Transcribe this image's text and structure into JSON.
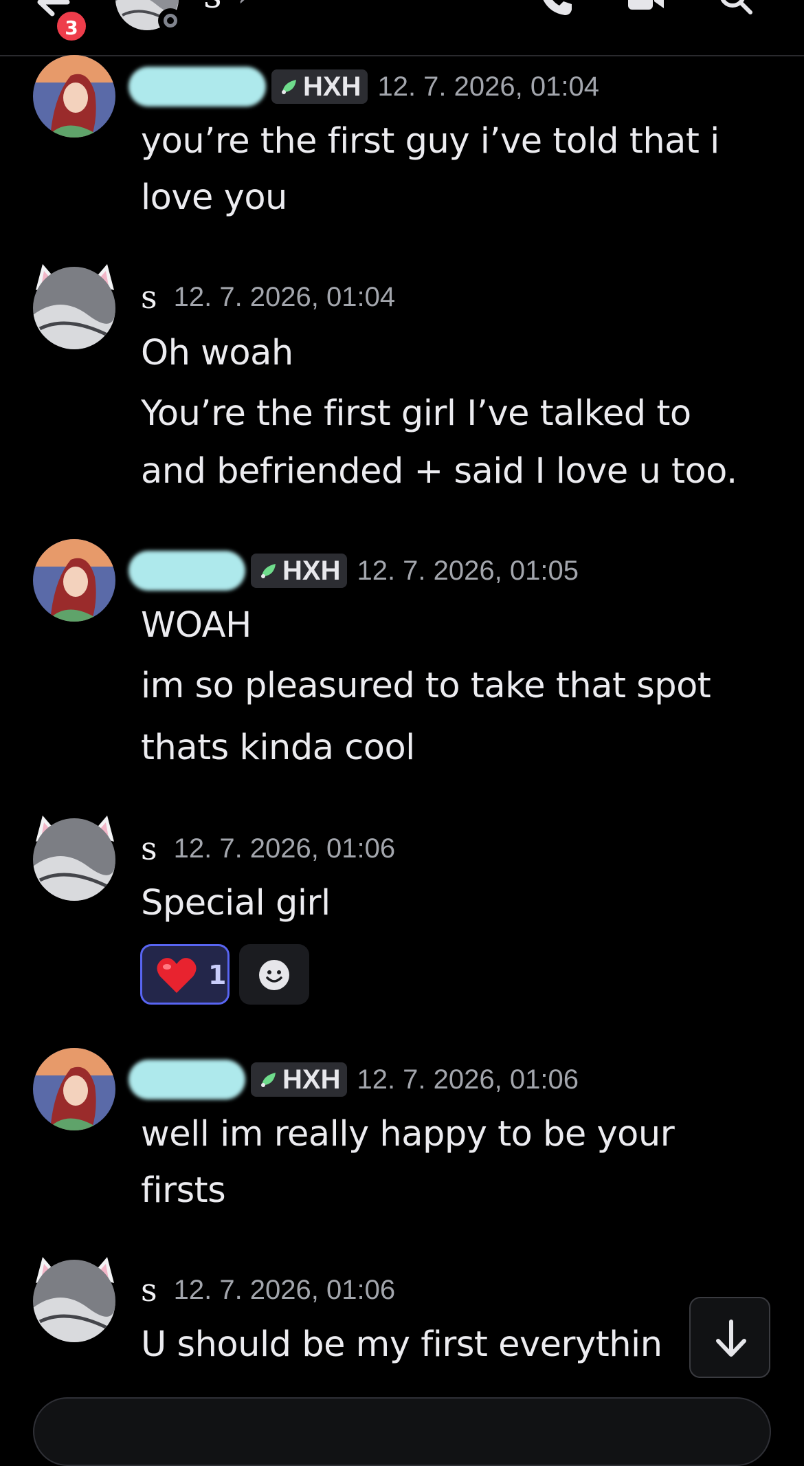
{
  "header": {
    "channel_name": "s",
    "chevron": "›",
    "unread_badge": "3",
    "icons": [
      "back-arrow-icon",
      "phone-icon",
      "video-camera-icon",
      "search-icon"
    ]
  },
  "messages": [
    {
      "author_type": "blurred",
      "tag": "HXH",
      "timestamp": "12. 7. 2026, 01:04",
      "lines": [
        "you’re the first guy i’ve told that  i",
        "love you"
      ]
    },
    {
      "author_type": "named",
      "author": "s",
      "timestamp": "12. 7. 2026, 01:04",
      "lines": [
        "Oh woah",
        "You’re the first girl I’ve talked to",
        "and befriended + said I love u too."
      ]
    },
    {
      "author_type": "blurred",
      "tag": "HXH",
      "timestamp": "12. 7. 2026, 01:05",
      "lines": [
        "WOAH",
        "im so pleasured to take that spot",
        "thats kinda cool"
      ]
    },
    {
      "author_type": "named",
      "author": "s",
      "timestamp": "12. 7. 2026, 01:06",
      "lines": [
        "Special girl"
      ],
      "reaction": {
        "emoji": "heart",
        "count": "1"
      }
    },
    {
      "author_type": "blurred",
      "tag": "HXH",
      "timestamp": "12. 7. 2026, 01:06",
      "lines": [
        "well im really happy to be your",
        "firsts"
      ]
    },
    {
      "author_type": "named",
      "author": "s",
      "timestamp": "12. 7. 2026, 01:06",
      "lines": [
        "U should be my first everythin"
      ]
    }
  ],
  "colors": {
    "background": "#000000",
    "tag_bg": "#2c2d32",
    "reaction_border": "#5865f2",
    "badge": "#ee3d4b",
    "blur_name": "#aee9ec"
  }
}
